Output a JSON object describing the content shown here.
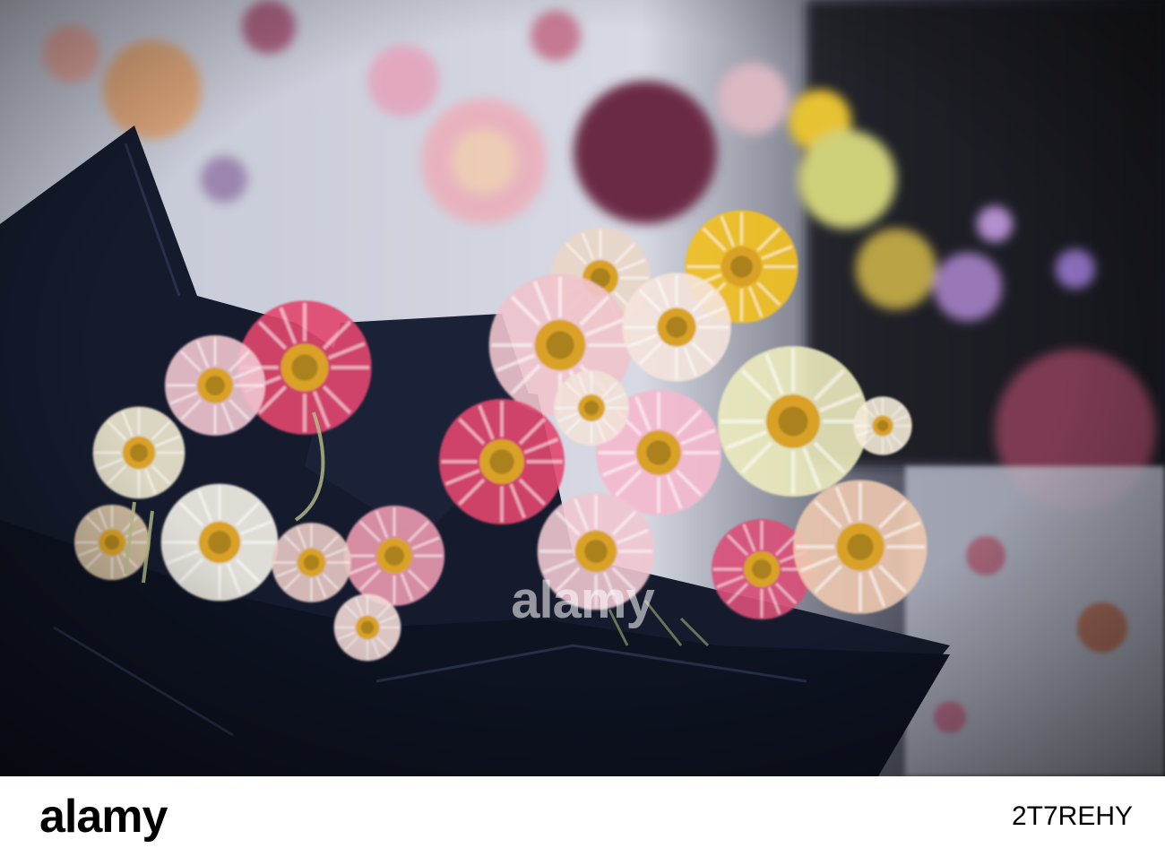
{
  "watermark": {
    "text": "alamy"
  },
  "footer": {
    "logo_text": "alamy",
    "image_id": "2T7REHY"
  },
  "palette": {
    "background_wall": "#c9ccd8",
    "wrap_paper": "#141a2b",
    "pink": "#e2456e",
    "pale_pink": "#f2c6d0",
    "cream": "#efe9c9",
    "yellow": "#f2c01f",
    "plum": "#6b2a44"
  }
}
